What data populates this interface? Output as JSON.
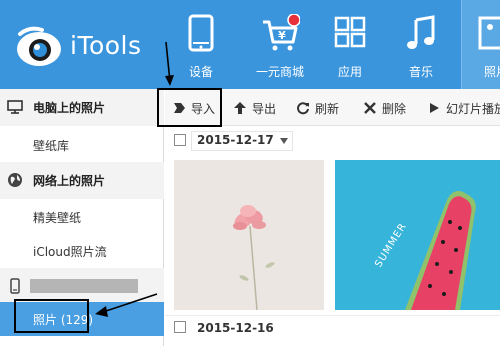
{
  "app": {
    "name": "iTools"
  },
  "header": {
    "nav": [
      {
        "label": "设备",
        "icon": "phone-icon"
      },
      {
        "label": "一元商城",
        "icon": "cart-icon"
      },
      {
        "label": "应用",
        "icon": "apps-grid-icon"
      },
      {
        "label": "音乐",
        "icon": "music-note-icon"
      },
      {
        "label": "照片",
        "icon": "photo-icon"
      }
    ],
    "colors": {
      "bar": "#3a95dd",
      "active": "#5aa8e4"
    }
  },
  "sidebar": {
    "sections": [
      {
        "title": "电脑上的照片",
        "icon": "monitor-icon",
        "items": [
          {
            "label": "壁纸库"
          }
        ]
      },
      {
        "title": "网络上的照片",
        "icon": "globe-icon",
        "items": [
          {
            "label": "精美壁纸"
          },
          {
            "label": "iCloud照片流"
          }
        ]
      }
    ],
    "device": {
      "icon": "device-icon",
      "photos_item": "照片 (129)"
    },
    "selected_color": "#4a9fe3"
  },
  "toolbar": {
    "import": "导入",
    "export": "导出",
    "refresh": "刷新",
    "delete": "删除",
    "slideshow": "幻灯片播放"
  },
  "content": {
    "groups": [
      {
        "date": "2015-12-17"
      },
      {
        "date": "2015-12-16"
      }
    ]
  }
}
